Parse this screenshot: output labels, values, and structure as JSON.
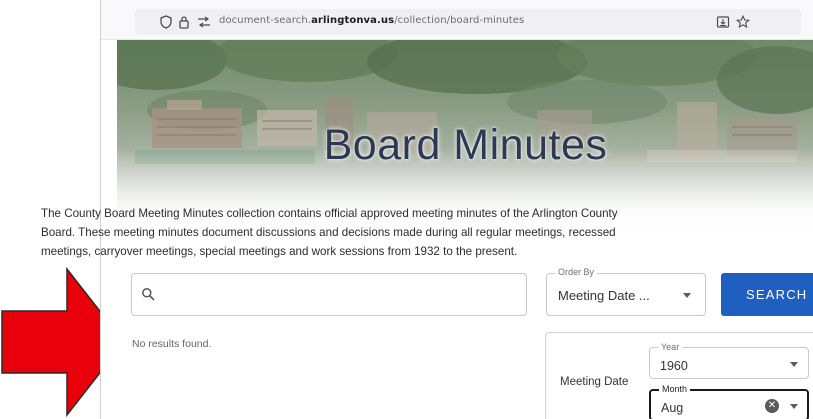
{
  "browser": {
    "url_prefix": "document-search.",
    "url_domain": "arlingtonva.us",
    "url_path": "/collection/board-minutes"
  },
  "page": {
    "title": "Board Minutes",
    "description_lines": [
      "The County Board Meeting Minutes collection contains official approved meeting minutes of the Arlington County",
      "Board. These meeting minutes document discussions and decisions made during all regular meetings, recessed",
      "meetings, carryover meetings, special meetings and work sessions from 1932 to the present."
    ]
  },
  "search": {
    "placeholder": "",
    "order_by_label": "Order By",
    "order_by_value": "Meeting Date ...",
    "button_label": "SEARCH"
  },
  "results": {
    "message": "No results found."
  },
  "filters": {
    "label": "Meeting Date",
    "year_label": "Year",
    "year_value": "1960",
    "month_label": "Month",
    "month_value": "Aug"
  },
  "annotation": {
    "arrow_color": "#e8000b"
  }
}
